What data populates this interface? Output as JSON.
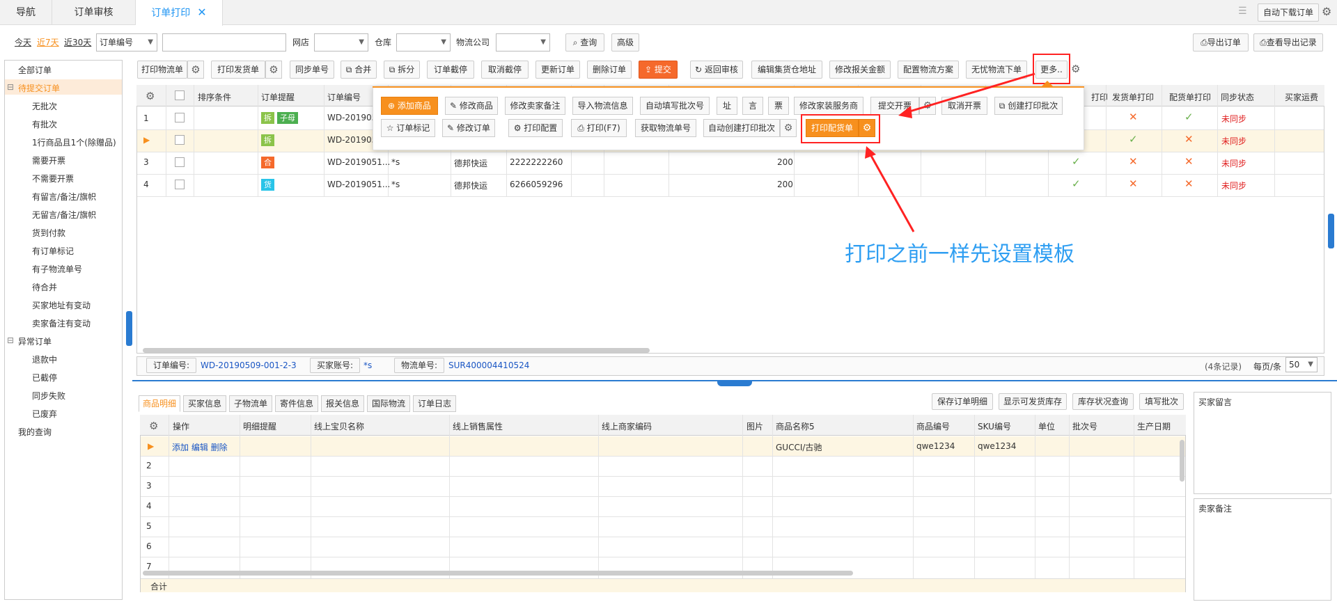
{
  "tabs": {
    "nav": "导航",
    "audit": "订单审核",
    "print": "订单打印",
    "print_close": "✕"
  },
  "topright": {
    "auto_download": "自动下载订单"
  },
  "filter": {
    "today": "今天",
    "last7": "近7天",
    "last30": "近30天",
    "field": "订单编号",
    "shop_label": "网店",
    "warehouse_label": "仓库",
    "logistics_label": "物流公司",
    "query": "查询",
    "advanced": "高级",
    "export": "导出订单",
    "view_export": "查看导出记录"
  },
  "sidebar": {
    "items": [
      "全部订单",
      "待提交订单",
      "无批次",
      "有批次",
      "1行商品且1个(除赠品)",
      "需要开票",
      "不需要开票",
      "有留言/备注/旗帜",
      "无留言/备注/旗帜",
      "货到付款",
      "有订单标记",
      "有子物流单号",
      "待合并",
      "买家地址有变动",
      "卖家备注有变动",
      "异常订单",
      "退款中",
      "已截停",
      "同步失败",
      "已废弃",
      "我的查询"
    ]
  },
  "toolbar": {
    "print_logistics": "打印物流单",
    "print_shipping": "打印发货单",
    "sync_no": "同步单号",
    "merge": "合并",
    "split": "拆分",
    "intercept": "订单截停",
    "cancel_intercept": "取消截停",
    "update": "更新订单",
    "delete": "删除订单",
    "submit": "提交",
    "return_audit": "返回审核",
    "edit_consolidation": "编辑集货仓地址",
    "edit_customs": "修改报关金额",
    "config_logistics": "配置物流方案",
    "worry_free": "无忧物流下单",
    "more": "更多.."
  },
  "table": {
    "headers": [
      "排序条件",
      "订单提醒",
      "订单编号",
      "打印",
      "发货单打印",
      "配货单打印",
      "同步状态",
      "买家运费"
    ],
    "rows": [
      {
        "no": "1",
        "order": "WD-2019050",
        "badges": [
          "拆",
          "子母"
        ]
      },
      {
        "no": "▶",
        "order": "WD-2019050",
        "badges": [
          "拆"
        ]
      },
      {
        "no": "3",
        "order": "WD-2019051...",
        "badges": [
          "合"
        ],
        "buyer": "*s",
        "carrier": "德邦快运",
        "waybill": "2222222260",
        "qty": "200"
      },
      {
        "no": "4",
        "order": "WD-2019051...",
        "badges": [
          "货"
        ],
        "buyer": "*s",
        "carrier": "德邦快运",
        "waybill": "6266059296",
        "qty": "200"
      }
    ],
    "sync": "未同步"
  },
  "more_popup": {
    "row1": [
      "添加商品",
      "修改商品",
      "修改卖家备注",
      "导入物流信息",
      "自动填写批次号",
      "址",
      "言",
      "票",
      "修改家装服务商",
      "提交开票",
      "取消开票",
      "创建打印批次"
    ],
    "row2": [
      "订单标记",
      "修改订单",
      "打印配置",
      "打印(F7)",
      "获取物流单号",
      "自动创建打印批次",
      "打印配货单"
    ]
  },
  "annotation": "打印之前一样先设置模板",
  "status": {
    "order_label": "订单编号:",
    "order_value": "WD-20190509-001-2-3",
    "buyer_label": "买家账号:",
    "buyer_value": "*s",
    "waybill_label": "物流单号:",
    "waybill_value": "SUR400004410524",
    "records": "(4条记录)",
    "per_page": "每页/条",
    "per_page_value": "50"
  },
  "bottom_tabs": [
    "商品明细",
    "买家信息",
    "子物流单",
    "寄件信息",
    "报关信息",
    "国际物流",
    "订单日志"
  ],
  "bottom_actions": [
    "保存订单明细",
    "显示可发货库存",
    "库存状况查询",
    "填写批次"
  ],
  "detail": {
    "headers": [
      "操作",
      "明细提醒",
      "线上宝贝名称",
      "线上销售属性",
      "线上商家编码",
      "图片",
      "商品名称5",
      "商品编号",
      "SKU编号",
      "单位",
      "批次号",
      "生产日期"
    ],
    "row1": {
      "ops": "添加 编辑 删除",
      "name": "GUCCI/古驰",
      "code": "qwe1234",
      "sku": "qwe1234"
    },
    "rownums": [
      "2",
      "3",
      "4",
      "5",
      "6",
      "7"
    ],
    "total": "合计"
  },
  "right_panels": {
    "buyer_msg": "买家留言",
    "seller_note": "卖家备注"
  },
  "colors": {
    "accent": "#2196f3",
    "orange": "#f7901e",
    "red": "#f22"
  }
}
